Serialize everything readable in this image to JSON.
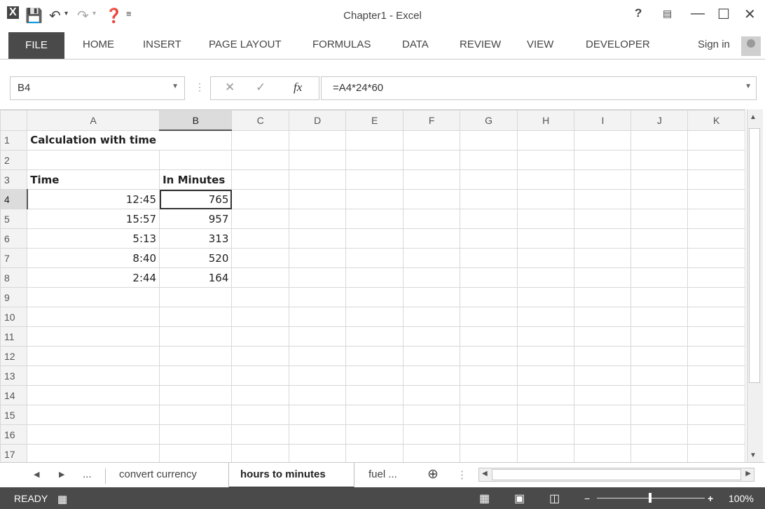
{
  "window": {
    "title": "Chapter1 - Excel",
    "sign_in": "Sign in"
  },
  "ribbon": {
    "tabs": [
      "FILE",
      "HOME",
      "INSERT",
      "PAGE LAYOUT",
      "FORMULAS",
      "DATA",
      "REVIEW",
      "VIEW",
      "DEVELOPER"
    ]
  },
  "formula_bar": {
    "name_box": "B4",
    "formula": "=A4*24*60",
    "fx_label": "fx"
  },
  "grid": {
    "columns": [
      "A",
      "B",
      "C",
      "D",
      "E",
      "F",
      "G",
      "H",
      "I",
      "J",
      "K"
    ],
    "rows": [
      "1",
      "2",
      "3",
      "4",
      "5",
      "6",
      "7",
      "8",
      "9",
      "10",
      "11",
      "12",
      "13",
      "14",
      "15",
      "16",
      "17"
    ],
    "active_cell": "B4",
    "cells": {
      "A1": "Calculation with time",
      "A3": "Time",
      "B3": "In Minutes",
      "A4": "12:45",
      "B4": "765",
      "A5": "15:57",
      "B5": "957",
      "A6": "5:13",
      "B6": "313",
      "A7": "8:40",
      "B7": "520",
      "A8": "2:44",
      "B8": "164"
    }
  },
  "sheet_tabs": {
    "ellipsis": "...",
    "tabs": [
      "convert currency",
      "hours to minutes",
      "fuel ..."
    ],
    "active": "hours to minutes"
  },
  "status_bar": {
    "status": "READY",
    "zoom": "100%"
  },
  "colors": {
    "file_tab": "#4a4a4a",
    "status_bar": "#4a4a4a",
    "header_bg": "#f3f3f3",
    "selected_header": "#dcdcdc"
  }
}
